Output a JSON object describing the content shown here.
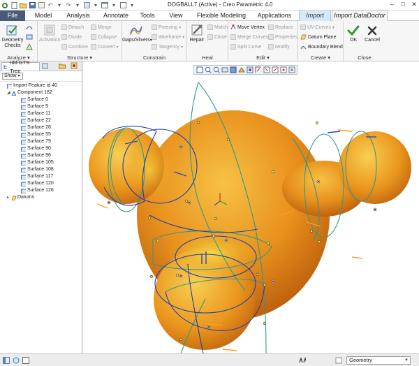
{
  "window": {
    "title": "DOGBALL7 (Active) - Creo Parametric 4.0"
  },
  "tabs": [
    {
      "label": "File"
    },
    {
      "label": "Model"
    },
    {
      "label": "Analysis"
    },
    {
      "label": "Annotate"
    },
    {
      "label": "Tools"
    },
    {
      "label": "View"
    },
    {
      "label": "Flexible Modeling"
    },
    {
      "label": "Applications"
    },
    {
      "label": "Import"
    },
    {
      "label": "Import DataDoctor"
    }
  ],
  "ribbon": {
    "analyze": {
      "label": "Analyze",
      "geometry_checks": "Geometry Checks"
    },
    "structure": {
      "label": "Structure",
      "activation": "Activation",
      "detach": "Detach",
      "divide": "Divide",
      "combine": "Combine",
      "merge": "Merge",
      "collapse": "Collapse",
      "convert": "Convert"
    },
    "constrain": {
      "label": "Constrain",
      "gaps_slivers": "Gaps/Slivers",
      "freezing": "Freezing",
      "wireframe": "Wireframe",
      "tangency": "Tangency"
    },
    "heal": {
      "label": "Heal",
      "repair": "Repair",
      "match": "Match",
      "close": "Close"
    },
    "edit": {
      "label": "Edit",
      "move_vertex": "Move Vertex",
      "merge_curves": "Merge Curves",
      "split_curve": "Split Curve",
      "replace": "Replace",
      "properties": "Properties",
      "modify": "Modify"
    },
    "create": {
      "label": "Create",
      "uv_curves": "UV-Curves",
      "datum_plane": "Datum Plane",
      "boundary_blend": "Boundary Blend"
    },
    "close": {
      "label": "Close",
      "ok": "OK",
      "cancel": "Cancel"
    }
  },
  "panel": {
    "tab_label": "Idd GTS Tree",
    "show_label": "Show",
    "tree": {
      "import_feature": "Import Feature id 40",
      "component": "Component 182",
      "surfaces": [
        "Surface 0",
        "Surface 9",
        "Surface 11",
        "Surface 22",
        "Surface 28",
        "Surface 55",
        "Surface 79",
        "Surface 90",
        "Surface 96",
        "Surface 105",
        "Surface 108",
        "Surface 117",
        "Surface 120",
        "Surface 126"
      ],
      "datums": "Datums"
    }
  },
  "statusbar": {
    "filter_value": "Geometry"
  },
  "colors": {
    "file_tab": "#4a5a78",
    "import_tab": "#d6e9f8",
    "model_orange": "#e88e1a",
    "curve_blue": "#1f3fa8",
    "curve_teal": "#2e9a8a"
  }
}
